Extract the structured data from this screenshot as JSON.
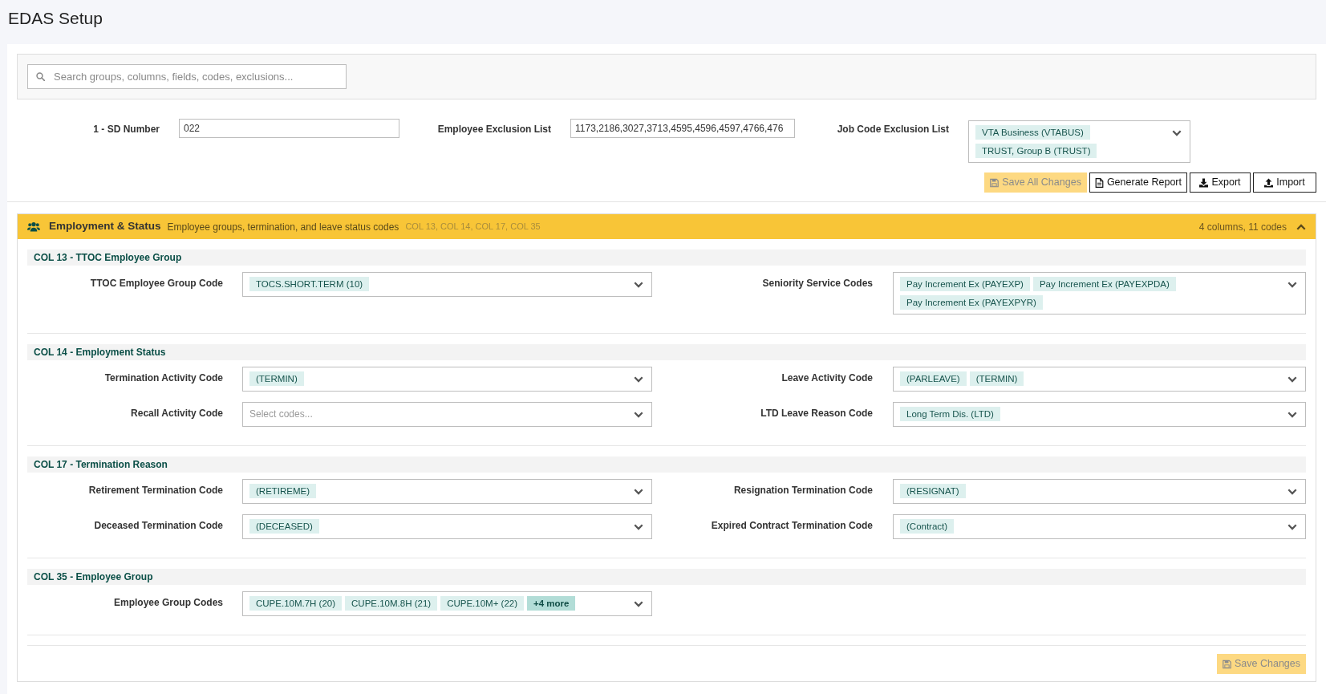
{
  "page_title": "EDAS Setup",
  "search": {
    "placeholder": "Search groups, columns, fields, codes, exclusions..."
  },
  "settings": [
    {
      "kind": "text",
      "label": "1 - SD Number",
      "value": "022"
    },
    {
      "kind": "text",
      "label": "Employee Exclusion List",
      "value": "1173,2186,3027,3713,4595,4596,4597,4766,476"
    },
    {
      "kind": "multiselect",
      "label": "Job Code Exclusion List",
      "chips": [
        {
          "kind": "code",
          "label": "VTA Business (VTABUS)"
        },
        {
          "kind": "code",
          "label": "TRUST, Group B (TRUST)"
        }
      ]
    }
  ],
  "actions": [
    {
      "kind": "save",
      "label": "Save All Changes",
      "disabled": true
    },
    {
      "kind": "report",
      "label": "Generate Report",
      "disabled": false
    },
    {
      "kind": "export",
      "label": "Export",
      "disabled": false
    },
    {
      "kind": "import",
      "label": "Import",
      "disabled": false
    }
  ],
  "section": {
    "title": "Employment & Status",
    "description": "Employee groups, termination, and leave status codes",
    "columns": "COL 13, COL 14, COL 17, COL 35",
    "summary": "4 columns, 11 codes",
    "expanded": true,
    "groups": [
      {
        "title": "COL 13 - TTOC Employee Group",
        "rows": [
          [
            {
              "label": "TTOC Employee Group Code",
              "chips": [
                {
                  "kind": "code",
                  "label": "TOCS.SHORT.TERM (10)"
                }
              ]
            },
            {
              "label": "Seniority Service Codes",
              "chips": [
                {
                  "kind": "code",
                  "label": "Pay Increment Ex (PAYEXP)"
                },
                {
                  "kind": "code",
                  "label": "Pay Increment Ex (PAYEXPDA)"
                },
                {
                  "kind": "code",
                  "label": "Pay Increment Ex (PAYEXPYR)"
                }
              ]
            }
          ]
        ]
      },
      {
        "title": "COL 14 - Employment Status",
        "rows": [
          [
            {
              "label": "Termination Activity Code",
              "chips": [
                {
                  "kind": "code",
                  "label": "(TERMIN)"
                }
              ]
            },
            {
              "label": "Leave Activity Code",
              "chips": [
                {
                  "kind": "code",
                  "label": "(PARLEAVE)"
                },
                {
                  "kind": "code",
                  "label": "(TERMIN)"
                }
              ]
            }
          ],
          [
            {
              "label": "Recall Activity Code",
              "placeholder": "Select codes..."
            },
            {
              "label": "LTD Leave Reason Code",
              "chips": [
                {
                  "kind": "code",
                  "label": "Long Term Dis. (LTD)"
                }
              ]
            }
          ]
        ]
      },
      {
        "title": "COL 17 - Termination Reason",
        "rows": [
          [
            {
              "label": "Retirement Termination Code",
              "chips": [
                {
                  "kind": "code",
                  "label": "(RETIREME)"
                }
              ]
            },
            {
              "label": "Resignation Termination Code",
              "chips": [
                {
                  "kind": "code",
                  "label": "(RESIGNAT)"
                }
              ]
            }
          ],
          [
            {
              "label": "Deceased Termination Code",
              "chips": [
                {
                  "kind": "code",
                  "label": "(DECEASED)"
                }
              ]
            },
            {
              "label": "Expired Contract Termination Code",
              "chips": [
                {
                  "kind": "code",
                  "label": "(Contract)"
                }
              ]
            }
          ]
        ]
      },
      {
        "title": "COL 35 - Employee Group",
        "rows": [
          [
            {
              "label": "Employee Group Codes",
              "chips": [
                {
                  "kind": "code",
                  "label": "CUPE.10M.7H (20)"
                },
                {
                  "kind": "code",
                  "label": "CUPE.10M.8H (21)"
                },
                {
                  "kind": "code",
                  "label": "CUPE.10M+ (22)"
                },
                {
                  "kind": "more",
                  "label": "+4 more"
                }
              ]
            }
          ]
        ]
      }
    ],
    "save_button": {
      "label": "Save Changes",
      "disabled": true
    }
  }
}
